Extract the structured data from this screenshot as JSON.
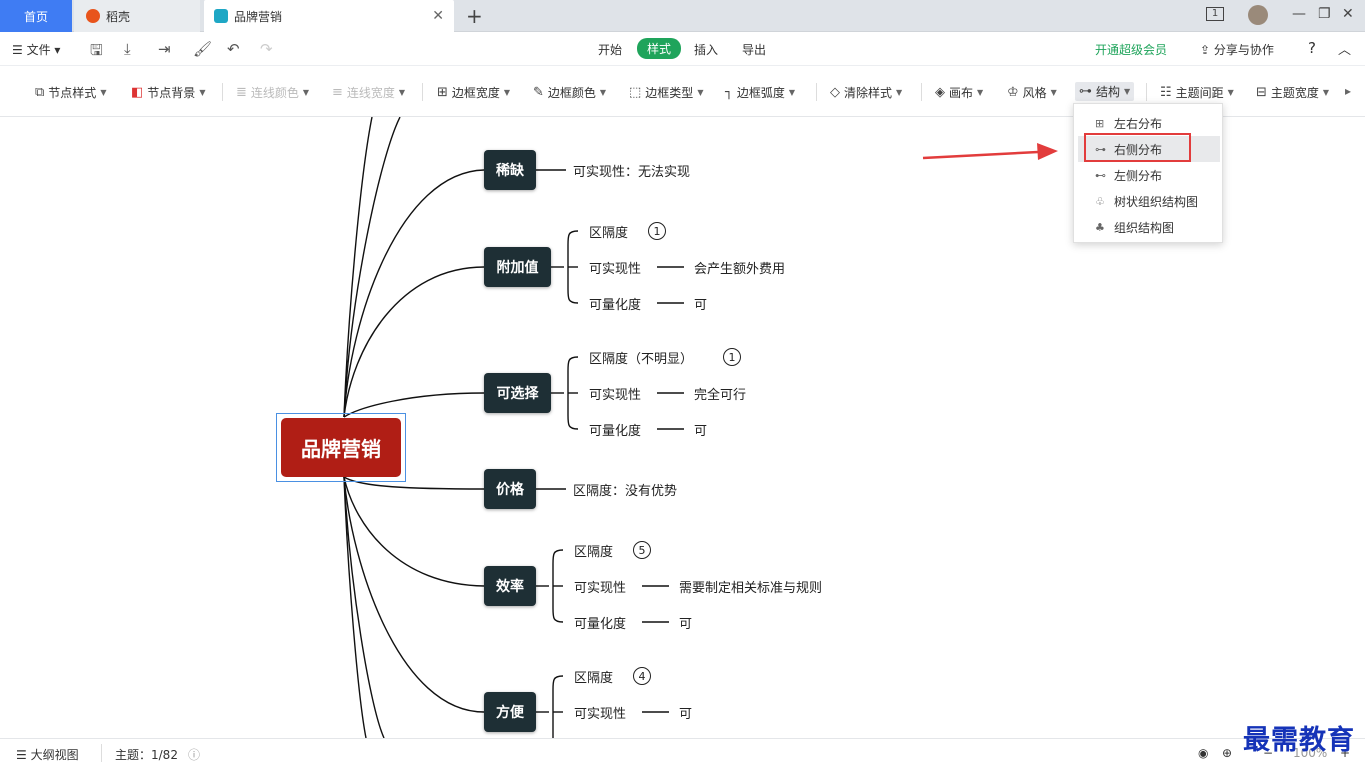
{
  "tabs": {
    "home": "首页",
    "daoke": "稻壳",
    "doc": "品牌营销",
    "colors": {
      "home_bg": "#3f7cf3",
      "daoke_icon": "#e8541c",
      "doc_icon": "#1ea7c5"
    }
  },
  "window": {
    "badge": "1"
  },
  "menubar": {
    "file": "文件",
    "tab_start": "开始",
    "tab_style": "样式",
    "tab_insert": "插入",
    "tab_export": "导出",
    "vip": "开通超级会员",
    "share": "分享与协作",
    "help": "?"
  },
  "ribbon": {
    "node_style": "节点样式",
    "node_bg": "节点背景",
    "line_color": "连线颜色",
    "line_width": "连线宽度",
    "border_width": "边框宽度",
    "border_color": "边框颜色",
    "border_type": "边框类型",
    "border_radius": "边框弧度",
    "clear_style": "清除样式",
    "canvas": "画布",
    "theme_style": "风格",
    "structure": "结构",
    "topic_spacing": "主题间距",
    "topic_width": "主题宽度"
  },
  "dropdown": {
    "items": [
      "左右分布",
      "右侧分布",
      "左侧分布",
      "树状组织结构图",
      "组织结构图"
    ],
    "selected": "右侧分布"
  },
  "mindmap": {
    "root": "品牌营销",
    "root_color": "#b01e15",
    "node_color": "#1e2f35",
    "branches": [
      {
        "title": "稀缺",
        "leaf": "可实现性：无法实现"
      },
      {
        "title": "附加值",
        "children": [
          {
            "label": "区隔度",
            "badge": "1"
          },
          {
            "label": "可实现性",
            "value": "会产生额外费用"
          },
          {
            "label": "可量化度",
            "value": "可"
          }
        ]
      },
      {
        "title": "可选择",
        "children": [
          {
            "label": "区隔度（不明显）",
            "badge": "1"
          },
          {
            "label": "可实现性",
            "value": "完全可行"
          },
          {
            "label": "可量化度",
            "value": "可"
          }
        ]
      },
      {
        "title": "价格",
        "leaf": "区隔度：没有优势"
      },
      {
        "title": "效率",
        "children": [
          {
            "label": "区隔度",
            "badge": "5"
          },
          {
            "label": "可实现性",
            "value": "需要制定相关标准与规则"
          },
          {
            "label": "可量化度",
            "value": "可"
          }
        ]
      },
      {
        "title": "方便",
        "children": [
          {
            "label": "区隔度",
            "badge": "4"
          },
          {
            "label": "可实现性",
            "value": "可"
          }
        ]
      }
    ]
  },
  "statusbar": {
    "outline": "大纲视图",
    "topic_count": "主题：1/82",
    "zoom": "100%"
  },
  "watermark": "最需教育",
  "annotation_color": "#e23c3c"
}
